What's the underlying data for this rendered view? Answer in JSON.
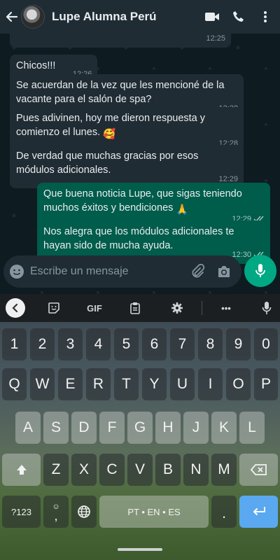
{
  "header": {
    "contact_name": "Lupe Alumna Perú"
  },
  "messages": [
    {
      "direction": "in",
      "text": "",
      "time": "12:25"
    },
    {
      "direction": "in",
      "text": "Chicos!!!",
      "time": "12:26"
    },
    {
      "direction": "in",
      "text": "Se acuerdan de la vez que les mencioné de la vacante para el salón de spa?",
      "time": "12:28"
    },
    {
      "direction": "in",
      "text": "Pues adivinen, hoy me dieron respuesta y comienzo el lunes.",
      "emoji": "🥰",
      "time": "12:28"
    },
    {
      "direction": "in",
      "text": "De verdad que muchas gracias por esos módulos adicionales.",
      "time": "12:29"
    },
    {
      "direction": "out",
      "text": "Que buena noticia Lupe, que sigas teniendo muchos éxitos y bendiciones",
      "emoji": "🙏",
      "time": "12:29",
      "status": "read"
    },
    {
      "direction": "out",
      "text": "Nos alegra que los módulos adicionales te hayan sido de mucha ayuda.",
      "time": "12:30",
      "status": "read"
    }
  ],
  "composer": {
    "placeholder": "Escribe un mensaje"
  },
  "keyboard": {
    "toolbar_gif": "GIF",
    "toolbar_more": "•••",
    "row_numbers": [
      "1",
      "2",
      "3",
      "4",
      "5",
      "6",
      "7",
      "8",
      "9",
      "0"
    ],
    "row_top": [
      "Q",
      "W",
      "E",
      "R",
      "T",
      "Y",
      "U",
      "I",
      "O",
      "P"
    ],
    "row_middle": [
      "A",
      "S",
      "D",
      "F",
      "G",
      "H",
      "J",
      "K",
      "L"
    ],
    "row_bottom": [
      "Z",
      "X",
      "C",
      "V",
      "B",
      "N",
      "M"
    ],
    "symbols_key": "?123",
    "comma_key": ",",
    "emoji_hint": "☺",
    "space_label": "PT • EN • ES",
    "period_key": "."
  },
  "colors": {
    "header_bg": "#1f2c34",
    "incoming_bubble": "#202c33",
    "outgoing_bubble": "#005c4b",
    "accent": "#00a884",
    "enter_key": "#5aa8f0"
  }
}
